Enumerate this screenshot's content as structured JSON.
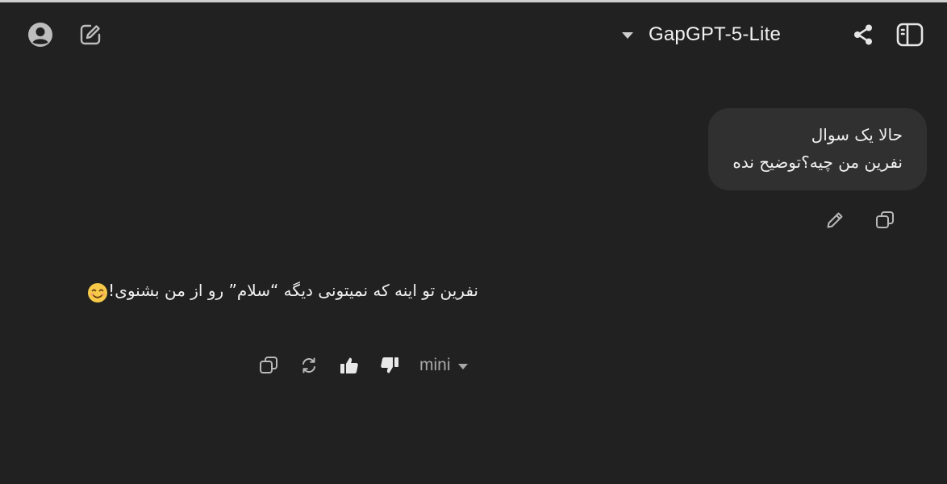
{
  "header": {
    "model_name": "GapGPT-5-Lite",
    "icons": [
      "account-icon",
      "new-chat-icon",
      "chevron-down-icon",
      "share-icon",
      "sidebar-icon"
    ]
  },
  "conversation": {
    "user_message": {
      "lines": [
        "حالا یک سوال",
        "نفرین من چیه؟توضیح نده"
      ]
    },
    "assistant_message": {
      "text": "نفرین تو اینه که نمیتونی دیگه “سلام” رو از من بشنوی!",
      "emoji": "smiling-face-emoji"
    },
    "response_model": "mini"
  },
  "colors": {
    "background": "#212121",
    "bubble": "#303030",
    "text": "#ececec",
    "icon": "#cfcfcf",
    "muted": "#a8a8a8"
  }
}
